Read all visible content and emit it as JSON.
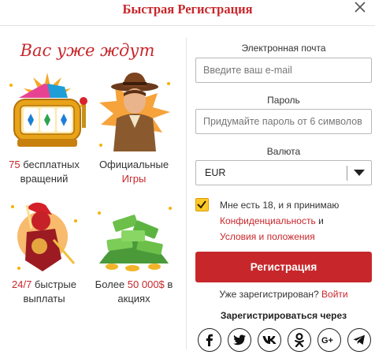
{
  "header": {
    "title": "Быстрая Регистрация",
    "close_glyph": "✕"
  },
  "promo": {
    "title": "Вас уже ждут",
    "features": [
      {
        "icon": "slot-machine-icon",
        "highlight": "75",
        "text": " бесплатных вращений"
      },
      {
        "icon": "adventurer-icon",
        "text": "Официальные ",
        "highlight": "Игры"
      },
      {
        "icon": "knight-icon",
        "highlight": "24/7",
        "text": " быстрые выплаты"
      },
      {
        "icon": "money-pile-icon",
        "text": "Более ",
        "highlight": "50 000$",
        "text2": " в акциях"
      }
    ]
  },
  "form": {
    "email_label": "Электронная почта",
    "email_placeholder": "Введите ваш e-mail",
    "password_label": "Пароль",
    "password_placeholder": "Придумайте пароль от 6 символов",
    "currency_label": "Валюта",
    "currency_value": "EUR",
    "terms_prefix": "Мне есть 18, и я принимаю",
    "privacy_link": "Конфиденциальность",
    "terms_and": " и",
    "terms_link": "Условия и положения",
    "checkbox_checked": true,
    "register_button": "Регистрация",
    "already_registered": "Уже зарегистрирован? ",
    "login_link": "Войти",
    "social_title": "Зарегистрироваться через"
  },
  "social": [
    "facebook-icon",
    "twitter-icon",
    "vk-icon",
    "odnoklassniki-icon",
    "google-plus-icon",
    "telegram-icon"
  ],
  "colors": {
    "accent": "#c8262b",
    "checkbox": "#ffc928",
    "divider": "#e4e4e4"
  }
}
